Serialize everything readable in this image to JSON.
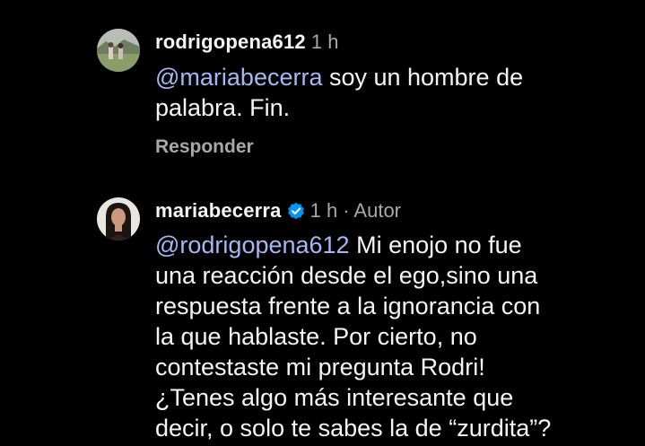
{
  "comments": [
    {
      "username": "rodrigopena612",
      "time": "1 h",
      "mention": "@mariabecerra",
      "lines": [
        " soy un hombre de",
        "palabra. Fin."
      ],
      "reply_label": "Responder"
    },
    {
      "username": "mariabecerra",
      "time": "1 h",
      "author_label": "· Autor",
      "verified": true,
      "mention": "@rodrigopena612",
      "lines": [
        " Mi enojo no fue",
        "una reacción desde el ego,sino una",
        "respuesta frente a la ignorancia con",
        "la que hablaste. Por cierto, no",
        "contestaste mi pregunta Rodri!"
      ],
      "extra_lines": [
        "¿Tenes algo más interesante que",
        "decir, o solo te sabes la de “zurdita”?"
      ]
    }
  ],
  "colors": {
    "background": "#000000",
    "text": "#f5f5f5",
    "muted": "#a8a8a8",
    "mention": "#a6b7f5",
    "verified": "#0095f6"
  }
}
